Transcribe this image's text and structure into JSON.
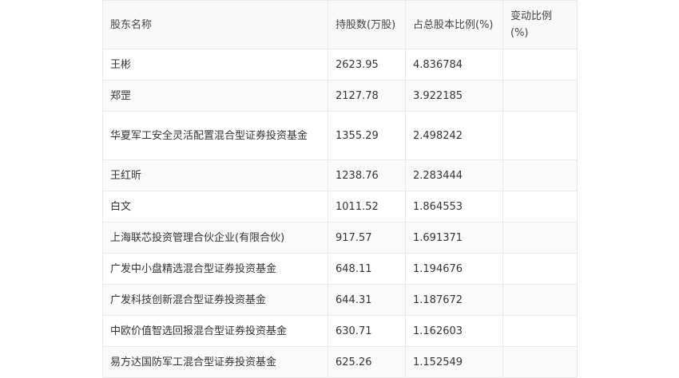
{
  "headers": [
    "股东名称",
    "持股数(万股)",
    "占总股本比例(%)",
    "变动比例(%)"
  ],
  "rows": [
    {
      "name": "王彬",
      "shares": "2623.95",
      "ratio": "4.836784",
      "change": ""
    },
    {
      "name": "郑罡",
      "shares": "2127.78",
      "ratio": "3.922185",
      "change": ""
    },
    {
      "name": "华夏军工安全灵活配置混合型证券投资基金",
      "shares": "1355.29",
      "ratio": "2.498242",
      "change": ""
    },
    {
      "name": "王红昕",
      "shares": "1238.76",
      "ratio": "2.283444",
      "change": ""
    },
    {
      "name": "白文",
      "shares": "1011.52",
      "ratio": "1.864553",
      "change": ""
    },
    {
      "name": "上海联芯投资管理合伙企业(有限合伙)",
      "shares": "917.57",
      "ratio": "1.691371",
      "change": ""
    },
    {
      "name": "广发中小盘精选混合型证券投资基金",
      "shares": "648.11",
      "ratio": "1.194676",
      "change": ""
    },
    {
      "name": "广发科技创新混合型证券投资基金",
      "shares": "644.31",
      "ratio": "1.187672",
      "change": ""
    },
    {
      "name": "中欧价值智选回报混合型证券投资基金",
      "shares": "630.71",
      "ratio": "1.162603",
      "change": ""
    },
    {
      "name": "易方达国防军工混合型证券投资基金",
      "shares": "625.26",
      "ratio": "1.152549",
      "change": ""
    }
  ]
}
